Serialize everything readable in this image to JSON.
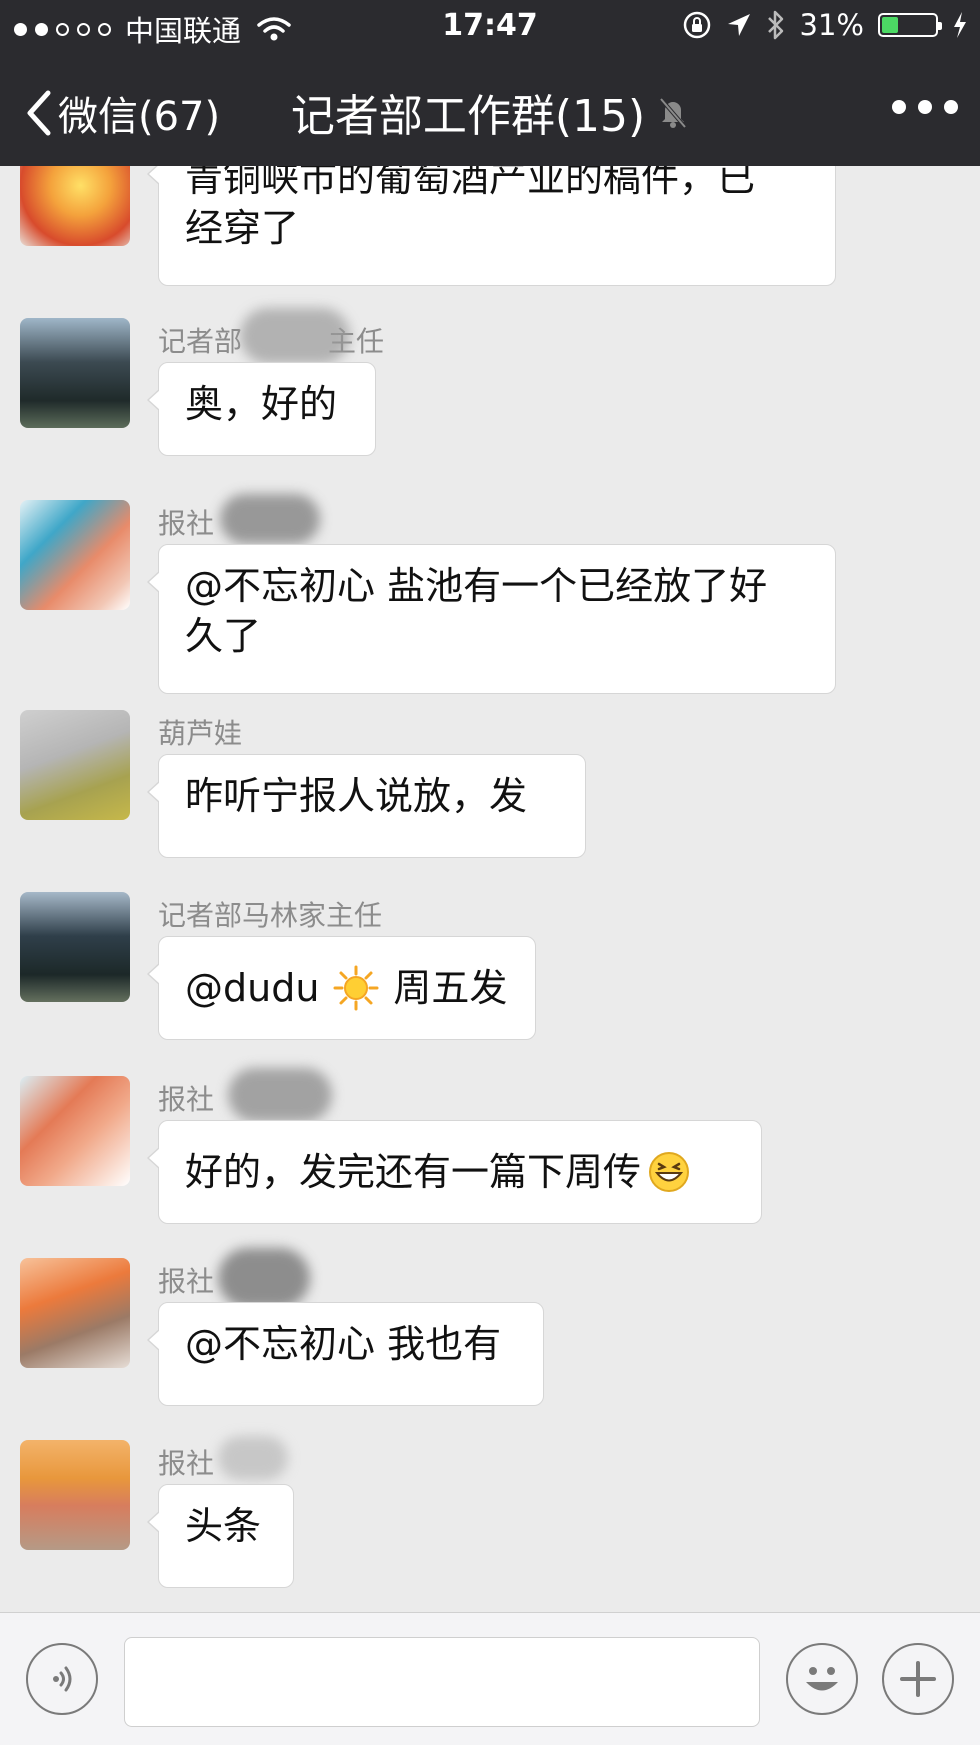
{
  "status_bar": {
    "carrier": "中国联通",
    "time": "17:47",
    "battery_percent": "31%",
    "battery_level": 0.31,
    "signal_bars_filled": 2,
    "signal_bars_total": 5
  },
  "nav": {
    "back_label": "微信(67)",
    "title": "记者部工作群(15)"
  },
  "messages": [
    {
      "sender": "",
      "lines": [
        "青铜峡市的葡萄酒产业的稿件，已",
        "经穿了"
      ]
    },
    {
      "sender": "记者部",
      "sender_suffix": "主任",
      "lines": [
        "奥，好的"
      ]
    },
    {
      "sender": "报社",
      "lines": [
        "@不忘初心 盐池有一个已经放了好",
        "久了"
      ]
    },
    {
      "sender": "葫芦娃",
      "lines": [
        "昨听宁报人说放，发"
      ]
    },
    {
      "sender": "记者部马林家主任",
      "lines": [
        "@dudu",
        "周五发"
      ]
    },
    {
      "sender": "报社",
      "lines": [
        "好的，发完还有一篇下周传"
      ]
    },
    {
      "sender": "报社",
      "lines": [
        "@不忘初心 我也有"
      ]
    },
    {
      "sender": "报社",
      "lines": [
        "头条"
      ]
    }
  ],
  "colors": {
    "header_bg": "#2b2b2f",
    "chat_bg": "#ebebeb",
    "bubble_bg": "#ffffff",
    "battery_green": "#4cd964"
  }
}
